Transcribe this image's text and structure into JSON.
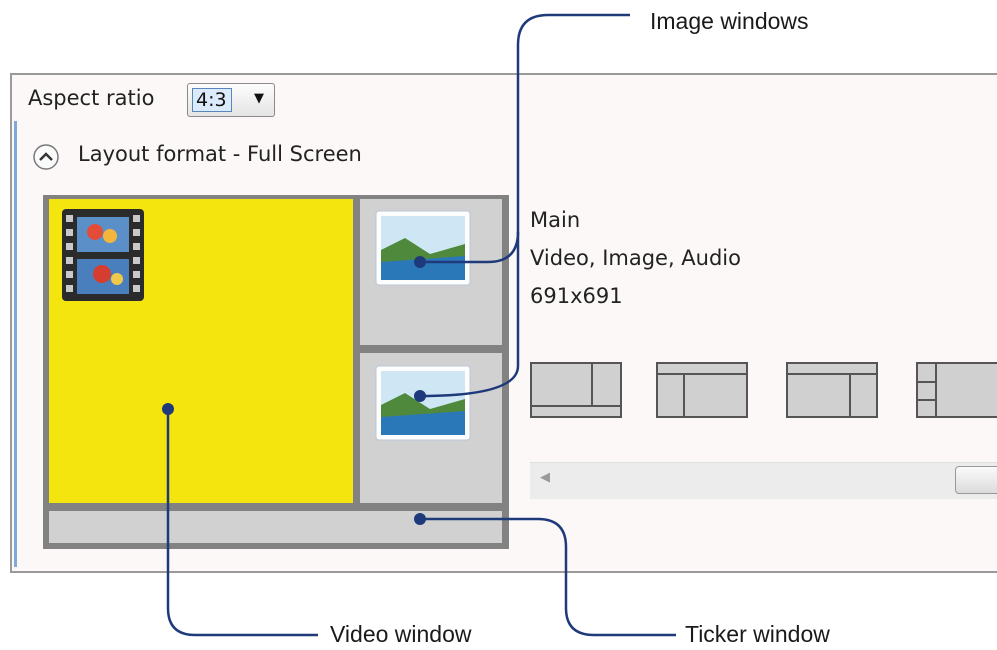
{
  "settings": {
    "aspect_label": "Aspect ratio",
    "aspect_value": "4:3",
    "layout_title": "Layout format - Full Screen"
  },
  "selected_window": {
    "name": "Main",
    "content_types": "Video, Image, Audio",
    "resolution": "691x691"
  },
  "callouts": {
    "image_windows": "Image windows",
    "video_window": "Video window",
    "ticker_window": "Ticker window"
  },
  "icons": {
    "collapse": "chevron-up-icon",
    "video": "film-strip-icon",
    "image": "landscape-photo-icon",
    "dropdown": "triangle-down-icon"
  },
  "colors": {
    "video_window": "#f5e50f",
    "image_window": "#d1d1d1",
    "frame": "#828282",
    "callout_line": "#1f3a7a",
    "panel_bg": "#fcf8f8"
  }
}
